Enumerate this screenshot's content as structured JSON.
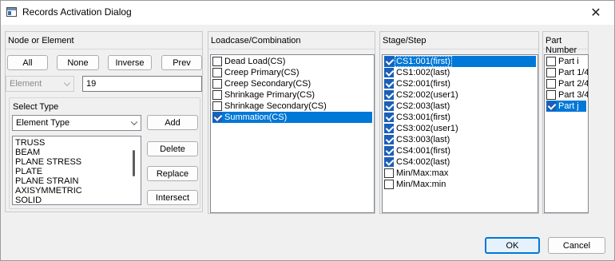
{
  "window": {
    "title": "Records Activation Dialog",
    "close_glyph": "✕"
  },
  "node_group": {
    "header": "Node or Element",
    "buttons": {
      "all": "All",
      "none": "None",
      "inverse": "Inverse",
      "prev": "Prev"
    },
    "mode_select": "Element",
    "id_value": "19",
    "select_type": {
      "label": "Select Type",
      "combo_value": "Element Type",
      "types": [
        "TRUSS",
        "BEAM",
        "PLANE STRESS",
        "PLATE",
        "PLANE STRAIN",
        "AXISYMMETRIC",
        "SOLID"
      ],
      "buttons": {
        "add": "Add",
        "delete": "Delete",
        "replace": "Replace",
        "intersect": "Intersect"
      }
    }
  },
  "loadcase_group": {
    "header": "Loadcase/Combination",
    "items": [
      {
        "label": "Dead Load(CS)",
        "checked": false,
        "selected": false
      },
      {
        "label": "Creep Primary(CS)",
        "checked": false,
        "selected": false
      },
      {
        "label": "Creep Secondary(CS)",
        "checked": false,
        "selected": false
      },
      {
        "label": "Shrinkage Primary(CS)",
        "checked": false,
        "selected": false
      },
      {
        "label": "Shrinkage Secondary(CS)",
        "checked": false,
        "selected": false
      },
      {
        "label": "Summation(CS)",
        "checked": true,
        "selected": true
      }
    ]
  },
  "stage_group": {
    "header": "Stage/Step",
    "items": [
      {
        "label": "CS1:001(first)",
        "checked": true,
        "selected": true
      },
      {
        "label": "CS1:002(last)",
        "checked": true,
        "selected": false
      },
      {
        "label": "CS2:001(first)",
        "checked": true,
        "selected": false
      },
      {
        "label": "CS2:002(user1)",
        "checked": true,
        "selected": false
      },
      {
        "label": "CS2:003(last)",
        "checked": true,
        "selected": false
      },
      {
        "label": "CS3:001(first)",
        "checked": true,
        "selected": false
      },
      {
        "label": "CS3:002(user1)",
        "checked": true,
        "selected": false
      },
      {
        "label": "CS3:003(last)",
        "checked": true,
        "selected": false
      },
      {
        "label": "CS4:001(first)",
        "checked": true,
        "selected": false
      },
      {
        "label": "CS4:002(last)",
        "checked": true,
        "selected": false
      },
      {
        "label": "Min/Max:max",
        "checked": false,
        "selected": false
      },
      {
        "label": "Min/Max:min",
        "checked": false,
        "selected": false
      }
    ]
  },
  "part_group": {
    "header": "Part Number",
    "items": [
      {
        "label": "Part   i",
        "checked": false,
        "selected": false
      },
      {
        "label": "Part 1/4",
        "checked": false,
        "selected": false
      },
      {
        "label": "Part 2/4",
        "checked": false,
        "selected": false
      },
      {
        "label": "Part 3/4",
        "checked": false,
        "selected": false
      },
      {
        "label": "Part   j",
        "checked": true,
        "selected": true
      }
    ]
  },
  "footer": {
    "ok": "OK",
    "cancel": "Cancel"
  }
}
